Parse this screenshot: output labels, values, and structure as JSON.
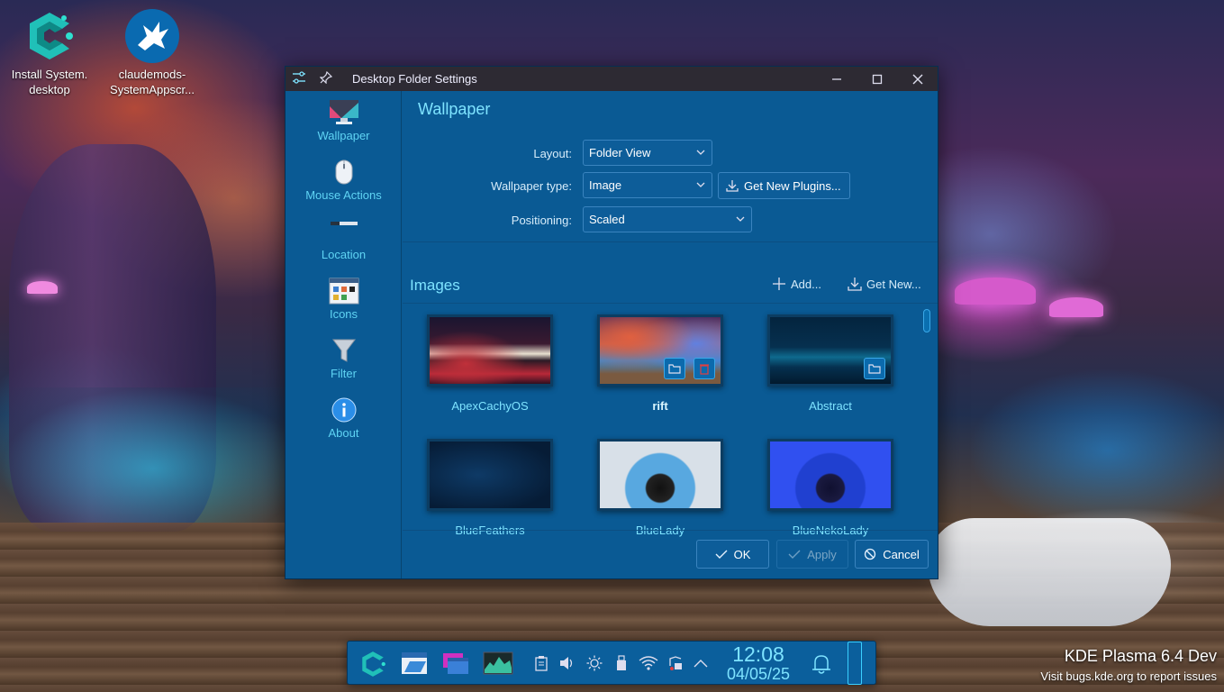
{
  "desktop": {
    "icons": [
      {
        "label_line1": "Install System.",
        "label_line2": "desktop",
        "icon": "cachyos-logo-icon"
      },
      {
        "label_line1": "claudemods-",
        "label_line2": "SystemAppscr...",
        "icon": "eagle-icon"
      }
    ],
    "watermark": {
      "title": "KDE Plasma 6.4 Dev",
      "subtitle": "Visit bugs.kde.org to report issues"
    }
  },
  "window": {
    "title": "Desktop Folder Settings",
    "sidebar": [
      {
        "label": "Wallpaper",
        "icon": "monitor-icon"
      },
      {
        "label": "Mouse Actions",
        "icon": "mouse-icon"
      },
      {
        "label": "Location",
        "icon": "location-bar-icon"
      },
      {
        "label": "Icons",
        "icon": "icons-grid-icon"
      },
      {
        "label": "Filter",
        "icon": "funnel-icon"
      },
      {
        "label": "About",
        "icon": "info-icon"
      }
    ],
    "page_title": "Wallpaper",
    "form": {
      "layout_label": "Layout:",
      "layout_value": "Folder View",
      "wallpaper_type_label": "Wallpaper type:",
      "wallpaper_type_value": "Image",
      "get_plugins_label": "Get New Plugins...",
      "positioning_label": "Positioning:",
      "positioning_value": "Scaled"
    },
    "images": {
      "heading": "Images",
      "add_label": "Add...",
      "get_new_label": "Get New...",
      "tiles": [
        {
          "name": "ApexCachyOS",
          "selected": false
        },
        {
          "name": "rift",
          "selected": true
        },
        {
          "name": "Abstract",
          "selected": false
        },
        {
          "name": "BlueFeathers",
          "selected": false
        },
        {
          "name": "BlueLady",
          "selected": false
        },
        {
          "name": "BlueNekoLady",
          "selected": false
        }
      ]
    },
    "buttons": {
      "ok": "OK",
      "apply": "Apply",
      "cancel": "Cancel"
    }
  },
  "panel": {
    "time": "12:08",
    "date": "04/05/25"
  },
  "colors": {
    "window_bg": "#0a5a94",
    "accent": "#7ee3ff",
    "titlebar": "#2d2a33"
  }
}
